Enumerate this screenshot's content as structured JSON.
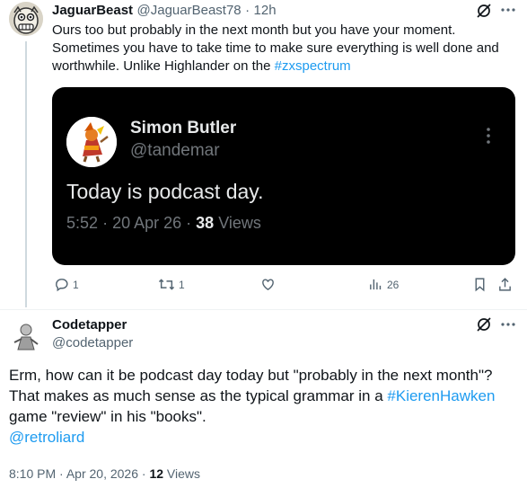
{
  "reply": {
    "author_name": "JaguarBeast",
    "author_handle": "@JaguarBeast78",
    "separator": "·",
    "time": "12h",
    "text_lines": [
      "Ours too but probably in the next month but you have your moment.",
      "Sometimes you have to take time to make sure everything is well done and",
      "worthwhile.  Unlike Highlander on the "
    ],
    "hashtag": "#zxspectrum",
    "quoted": {
      "author_name": "Simon Butler",
      "author_handle": "@tandemar",
      "text": "Today is podcast day.",
      "time": "5:52",
      "date": "20 Apr 26",
      "separator": "·",
      "views_count": "38",
      "views_label": "Views"
    },
    "actions": {
      "replies": "1",
      "reposts": "1",
      "likes": "",
      "views": "26"
    }
  },
  "main_post": {
    "author_name": "Codetapper",
    "author_handle": "@codetapper",
    "text_part1": "Erm, how can it be podcast day today but \"probably in the next month\"? That makes as much sense as the typical grammar in a ",
    "hashtag": "#KierenHawken",
    "text_part2": " game \"review\" in his \"books\".",
    "mention": "@retroliard",
    "time": "8:10 PM",
    "separator": "·",
    "date": "Apr 20, 2026",
    "views_count": "12",
    "views_label": "Views"
  },
  "icons": {
    "grok": "grok-icon",
    "more": "more-icon",
    "reply": "reply-icon",
    "repost": "repost-icon",
    "like": "like-icon",
    "views": "views-icon",
    "bookmark": "bookmark-icon",
    "share": "share-icon"
  },
  "colors": {
    "link": "#1d9bf0",
    "secondary_text": "#536471",
    "card_bg": "#000000"
  }
}
